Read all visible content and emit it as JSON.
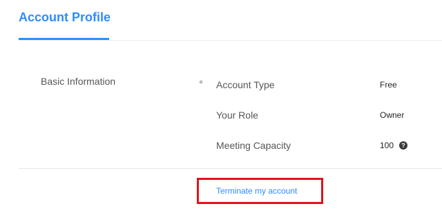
{
  "tabs": [
    {
      "label": "Account Profile",
      "active": true
    }
  ],
  "basic_information": {
    "section_label": "Basic Information",
    "fields": [
      {
        "label": "Account Type",
        "value": "Free"
      },
      {
        "label": "Your Role",
        "value": "Owner"
      },
      {
        "label": "Meeting Capacity",
        "value": "100",
        "help_icon": "help-circle-icon"
      }
    ]
  },
  "actions": {
    "terminate_link": "Terminate my account"
  },
  "colors": {
    "accent": "#2d8cff",
    "highlight": "#e3111b"
  }
}
